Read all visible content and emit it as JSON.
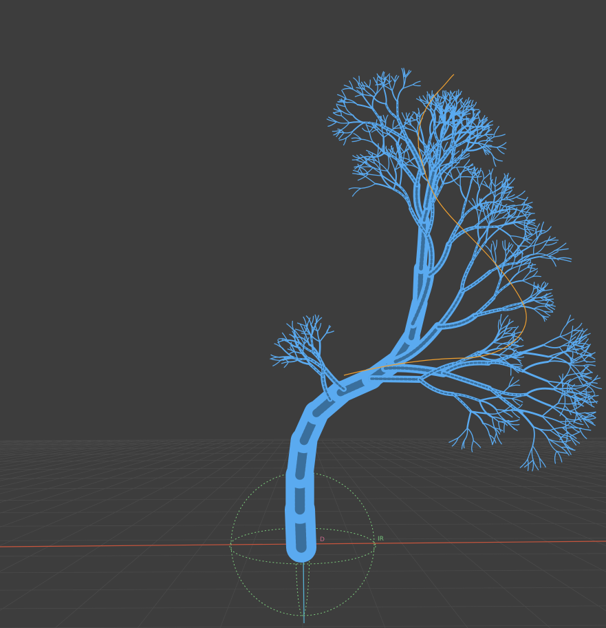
{
  "viewport": {
    "background": "#3d3d3d",
    "grid_color": "#4a4a4a",
    "x_axis_color": "#c8553d",
    "y_axis_color": "#57b6d8",
    "selection_color": "#5aaaf0",
    "wire_color": "#3a6f9c",
    "curve_color": "#f0a030",
    "gizmo_color": "#7fd07f"
  },
  "gizmo": {
    "label_d": "D",
    "label_r": "IR",
    "icon": "rotate-gizmo-icon"
  },
  "object": {
    "icon": "tree-mesh-icon"
  }
}
